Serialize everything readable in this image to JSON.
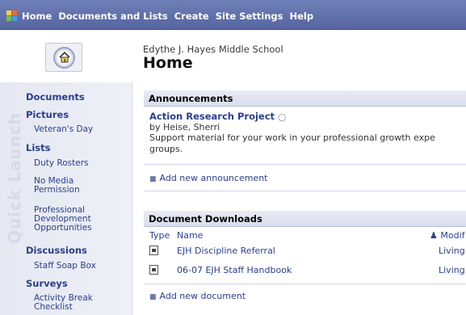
{
  "topnav": {
    "items": [
      "Home",
      "Documents and Lists",
      "Create",
      "Site Settings",
      "Help"
    ]
  },
  "header": {
    "site_name": "Edythe J. Hayes Middle School",
    "page_title": "Home"
  },
  "quick_launch": {
    "watermark": "Quick Launch",
    "groups": [
      {
        "heading": "Documents",
        "items": []
      },
      {
        "heading": "Pictures",
        "items": [
          "Veteran's Day"
        ]
      },
      {
        "heading": "Lists",
        "items": [
          "Duty Rosters",
          "No Media Permission",
          "Professional Development Opportunities"
        ]
      },
      {
        "heading": "Discussions",
        "items": [
          "Staff Soap Box"
        ]
      },
      {
        "heading": "Surveys",
        "items": [
          "Activity Break Checklist"
        ]
      }
    ]
  },
  "announcements": {
    "title": "Announcements",
    "item_title": "Action Research Project",
    "item_by": "by Heise, Sherri",
    "item_body_line1": "Support material for your work in your professional growth expe",
    "item_body_line2": "groups.",
    "add_link": "Add new announcement"
  },
  "documents": {
    "title": "Document Downloads",
    "columns": {
      "type": "Type",
      "name": "Name",
      "modified": "Modif"
    },
    "rows": [
      {
        "name": "EJH Discipline Referral",
        "modified": "Living"
      },
      {
        "name": "06-07 EJH Staff Handbook",
        "modified": "Living"
      }
    ],
    "add_link": "Add new document"
  }
}
